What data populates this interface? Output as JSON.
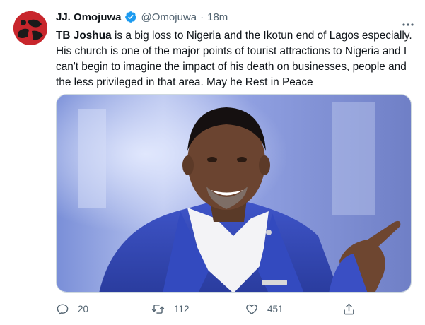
{
  "tweet": {
    "author_name": "JJ. Omojuwa",
    "handle": "@Omojuwa",
    "separator": "·",
    "time": "18m",
    "text_bold": "TB Joshua",
    "text_rest": " is a big loss to Nigeria and the Ikotun end of Lagos especially. His church is one of the major points of tourist attractions to Nigeria and I can't begin to imagine the impact of his death on businesses, people and the less privileged in that area. May he Rest in Peace",
    "replies": "20",
    "retweets": "112",
    "likes": "451"
  },
  "colors": {
    "verified": "#1d9bf0",
    "muted": "#536471",
    "avatar_red": "#c8262c"
  },
  "icons": {
    "verified": "verified-badge-icon",
    "more": "more-dots-icon",
    "reply": "reply-icon",
    "retweet": "retweet-icon",
    "like": "heart-icon",
    "share": "share-icon"
  }
}
